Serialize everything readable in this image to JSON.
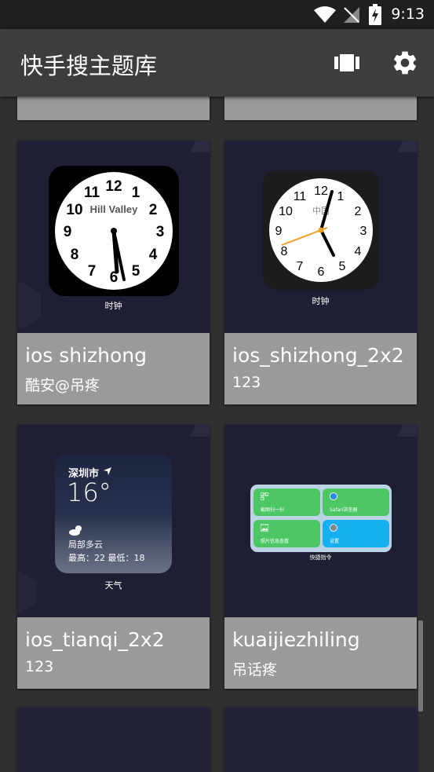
{
  "status_bar": {
    "time": "9:13"
  },
  "app_bar": {
    "title": "快手搜主题库",
    "icons": [
      "view-carousel-icon",
      "settings-icon"
    ]
  },
  "cards": [
    {
      "name": "ios shizhong",
      "author": "酷安@吊疼",
      "widget": {
        "clock_label": "Hill Valley",
        "caption": "时钟"
      }
    },
    {
      "name": "ios_shizhong_2x2",
      "author": "123",
      "widget": {
        "clock_label": "中国",
        "caption": "时钟"
      }
    },
    {
      "name": "ios_tianqi_2x2",
      "author": "123",
      "widget": {
        "city": "深圳市",
        "temperature": "16°",
        "condition": "局部多云",
        "range": "最高：22 最低：18",
        "caption": "天气"
      }
    },
    {
      "name": "kuaijiezhiling",
      "author": "吊话疼",
      "widget": {
        "items": [
          "截图扫一扫",
          "Safari浏览器",
          "照片信息查看",
          "设置"
        ],
        "caption": "快捷指令"
      }
    }
  ],
  "clock_numbers": [
    "12",
    "1",
    "2",
    "3",
    "4",
    "5",
    "6",
    "7",
    "8",
    "9",
    "10",
    "11"
  ]
}
